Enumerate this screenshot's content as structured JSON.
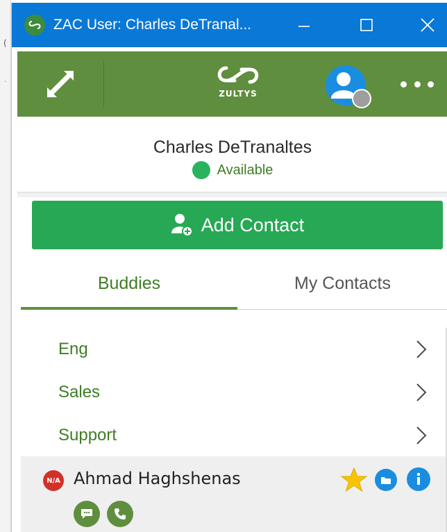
{
  "window": {
    "title": "ZAC User: Charles DeTranal...",
    "app_icon": "zultys-app-icon",
    "controls": {
      "minimize": "minimize-icon",
      "maximize": "maximize-icon",
      "close": "close-icon"
    },
    "titlebar_color": "#0a78d7"
  },
  "toolbar": {
    "color": "#5f8e3f",
    "expand_icon": "expand-icon",
    "logo_text": "ZULTYS",
    "avatar_status": "offline-gray",
    "more_icon": "more-icon"
  },
  "user": {
    "name": "Charles DeTranaltes",
    "status": "Available",
    "status_color": "#29b35e"
  },
  "add_contact": {
    "label": "Add Contact",
    "icon": "add-user-icon",
    "color": "#27a855"
  },
  "tabs": [
    {
      "label": "Buddies",
      "active": true
    },
    {
      "label": "My Contacts",
      "active": false
    }
  ],
  "groups": [
    {
      "label": "Eng"
    },
    {
      "label": "Sales"
    },
    {
      "label": "Support"
    }
  ],
  "contacts": [
    {
      "name": "Ahmad Haghshenas",
      "status_badge": "N/A",
      "status_color": "#d2312a",
      "favorite": true
    }
  ]
}
